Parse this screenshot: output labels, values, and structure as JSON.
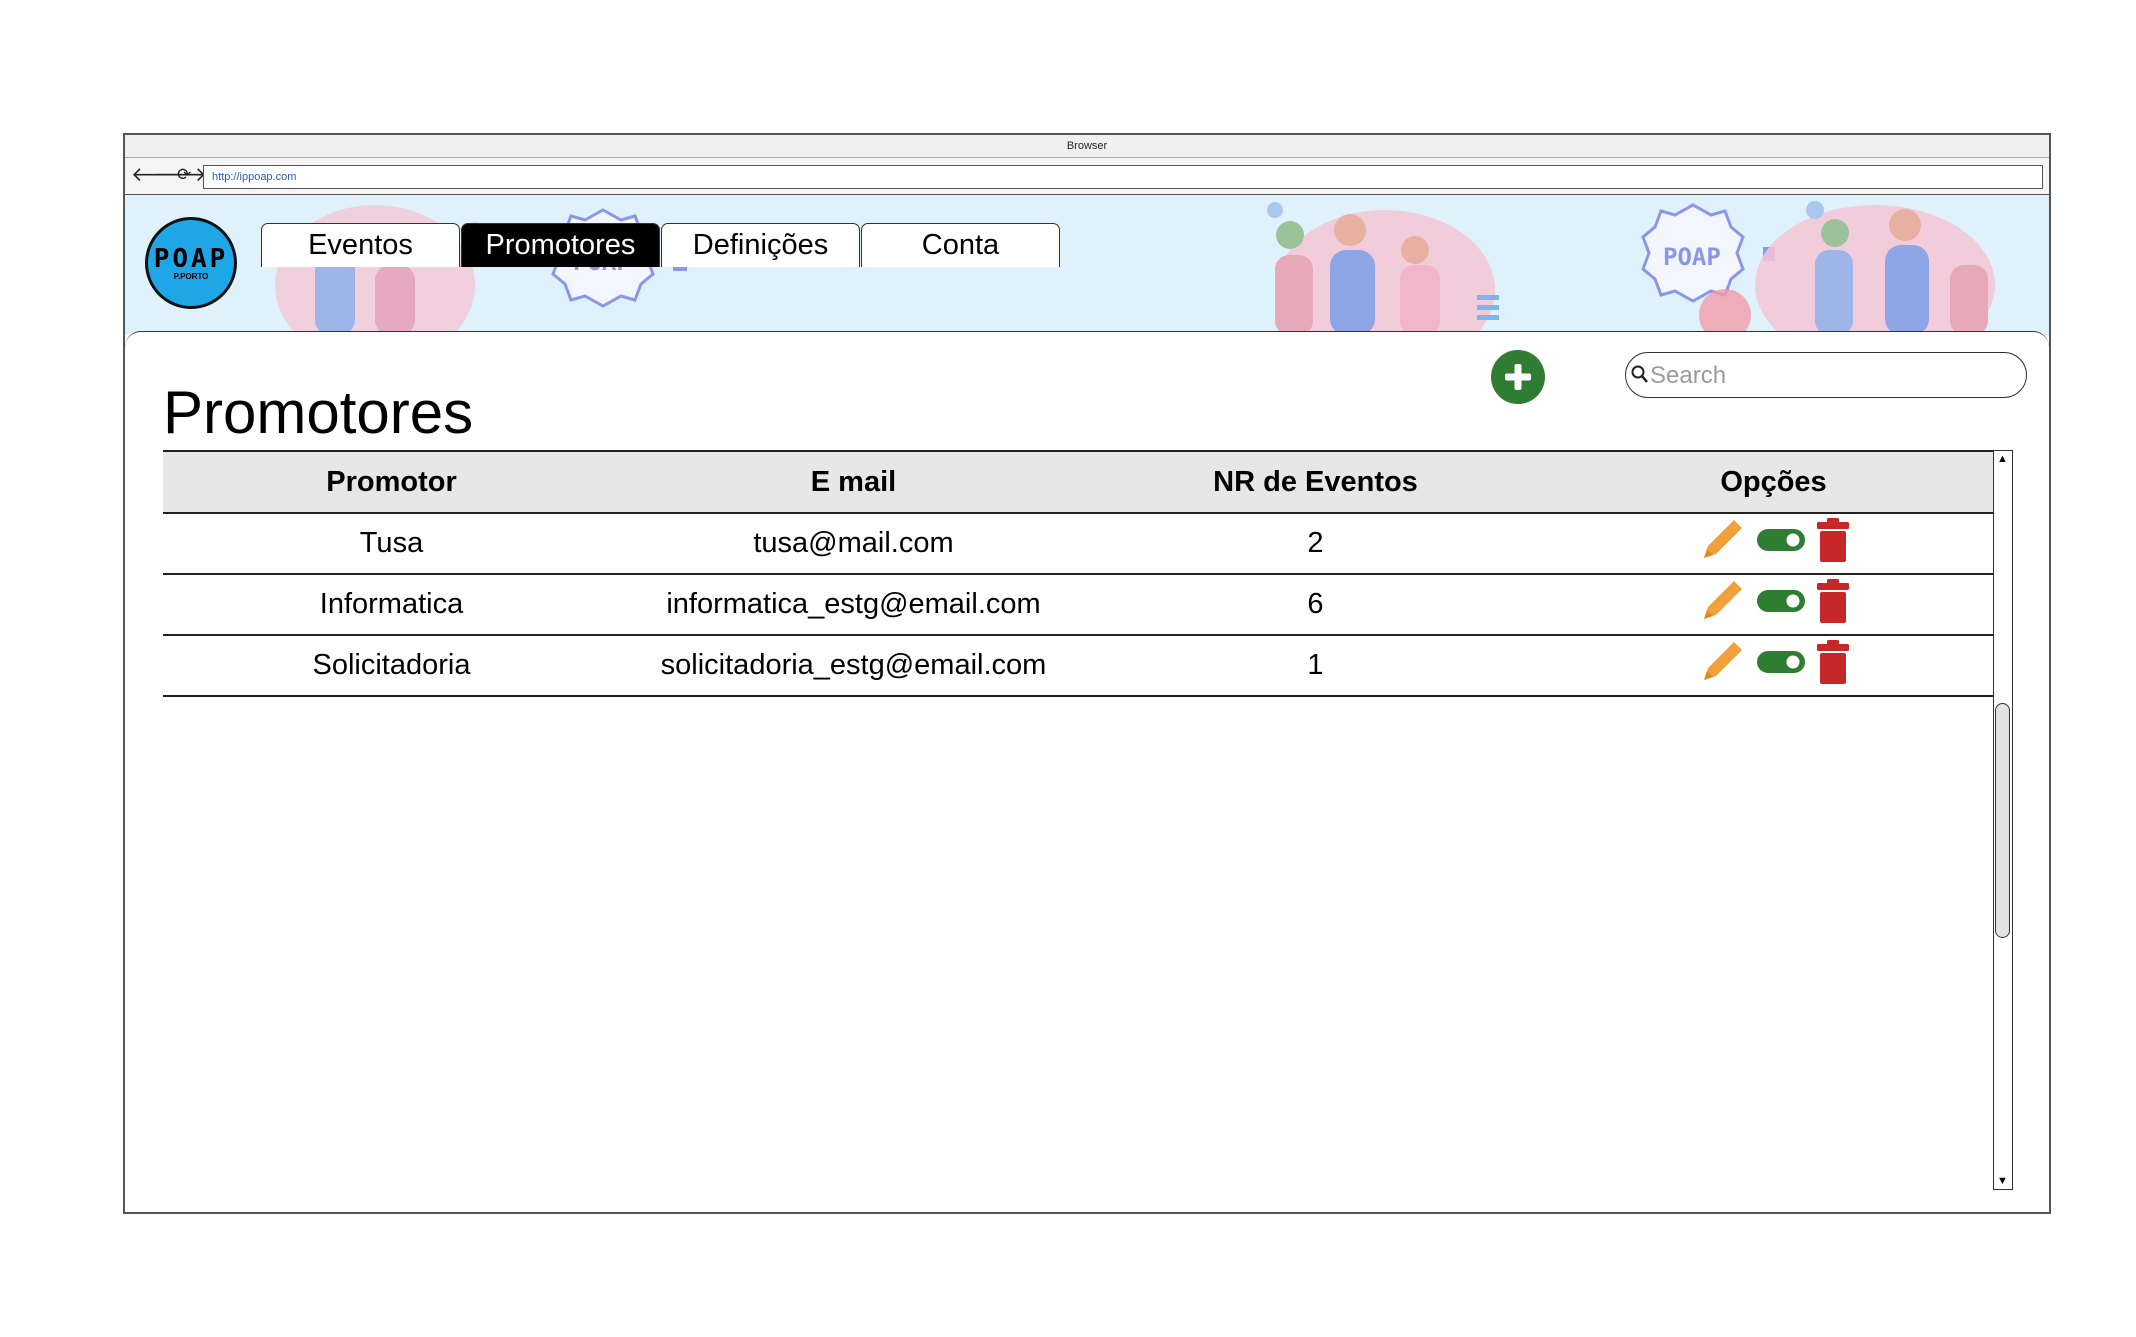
{
  "browser": {
    "title": "Browser",
    "url": "http://ippoap.com",
    "back_icon": "arrow-left-icon",
    "forward_icon": "arrow-right-icon",
    "reload_icon": "reload-icon"
  },
  "logo": {
    "main": "POAP",
    "sub": "P.PORTO"
  },
  "banner": {
    "badge_text": "POAP"
  },
  "tabs": [
    {
      "label": "Eventos",
      "active": false
    },
    {
      "label": "Promotores",
      "active": true
    },
    {
      "label": "Definições",
      "active": false
    },
    {
      "label": "Conta",
      "active": false
    }
  ],
  "page": {
    "title": "Promotores"
  },
  "search": {
    "placeholder": "Search",
    "value": ""
  },
  "table": {
    "headers": [
      "Promotor",
      "E mail",
      "NR de Eventos",
      "Opções"
    ],
    "rows": [
      {
        "promotor": "Tusa",
        "email": "tusa@mail.com",
        "eventos": "2",
        "active": true
      },
      {
        "promotor": "Informatica",
        "email": "informatica_estg@email.com",
        "eventos": "6",
        "active": true
      },
      {
        "promotor": "Solicitadoria",
        "email": "solicitadoria_estg@email.com",
        "eventos": "1",
        "active": true
      }
    ]
  },
  "colors": {
    "accent_green": "#2e7d32",
    "edit_orange": "#f0a23a",
    "delete_red": "#c62828",
    "banner_bg": "#dff2fc"
  }
}
